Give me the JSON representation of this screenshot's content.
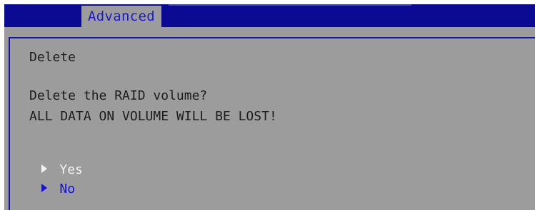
{
  "header": {
    "tabs": [
      {
        "label": "Advanced",
        "active": true
      }
    ]
  },
  "dialog": {
    "title": "Delete",
    "message_lines": [
      "Delete the RAID volume?",
      "ALL DATA ON VOLUME WILL BE LOST!"
    ],
    "options": [
      {
        "label": "Yes",
        "highlighted": true,
        "icon": "triangle-right-icon"
      },
      {
        "label": "No",
        "highlighted": false,
        "icon": "triangle-right-icon"
      }
    ]
  },
  "colors": {
    "header_bg": "#0a0a92",
    "panel_bg": "#9c9c9c",
    "tab_text": "#1a1ad0",
    "option_highlight": "#f2f2f2",
    "option_normal": "#1414d0",
    "text": "#1c1c1c"
  }
}
